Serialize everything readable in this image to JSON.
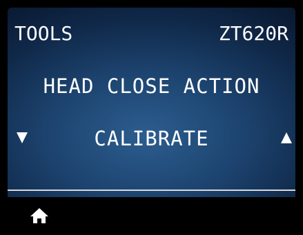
{
  "header": {
    "menu_title": "TOOLS",
    "printer_model": "ZT620R"
  },
  "setting": {
    "name": "HEAD CLOSE ACTION",
    "value": "CALIBRATE"
  },
  "icons": {
    "prev": "down-triangle-icon",
    "next": "up-triangle-icon",
    "home": "home-icon"
  },
  "colors": {
    "screen_center": "#2c5d8f",
    "screen_edge": "#061224",
    "text": "#ffffff",
    "footer": "#000000",
    "divider": "#d9d9d9"
  }
}
